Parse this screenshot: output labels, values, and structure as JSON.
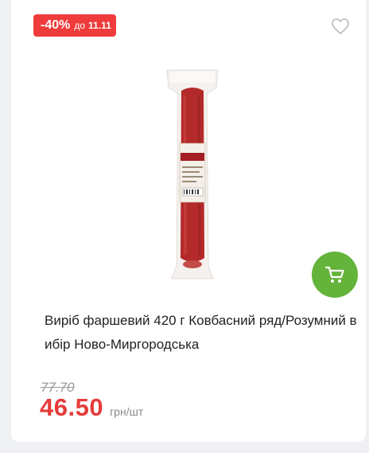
{
  "badge": {
    "discount": "-40%",
    "until_label": "до",
    "date": "11.11"
  },
  "product": {
    "title": "Виріб фаршевий 420 г Ковбасний ряд/Розумний вибір Ново-Миргородська",
    "label_brand": "КОВБАСНИЙ РЯД"
  },
  "price": {
    "old": "77.70",
    "current": "46.50",
    "unit": "грн/шт"
  },
  "icons": {
    "favorite": "heart-outline-icon",
    "cart": "cart-icon"
  },
  "colors": {
    "accent_red": "#ef3b3b",
    "cart_green": "#64b33a",
    "sausage": "#b42a2a"
  }
}
